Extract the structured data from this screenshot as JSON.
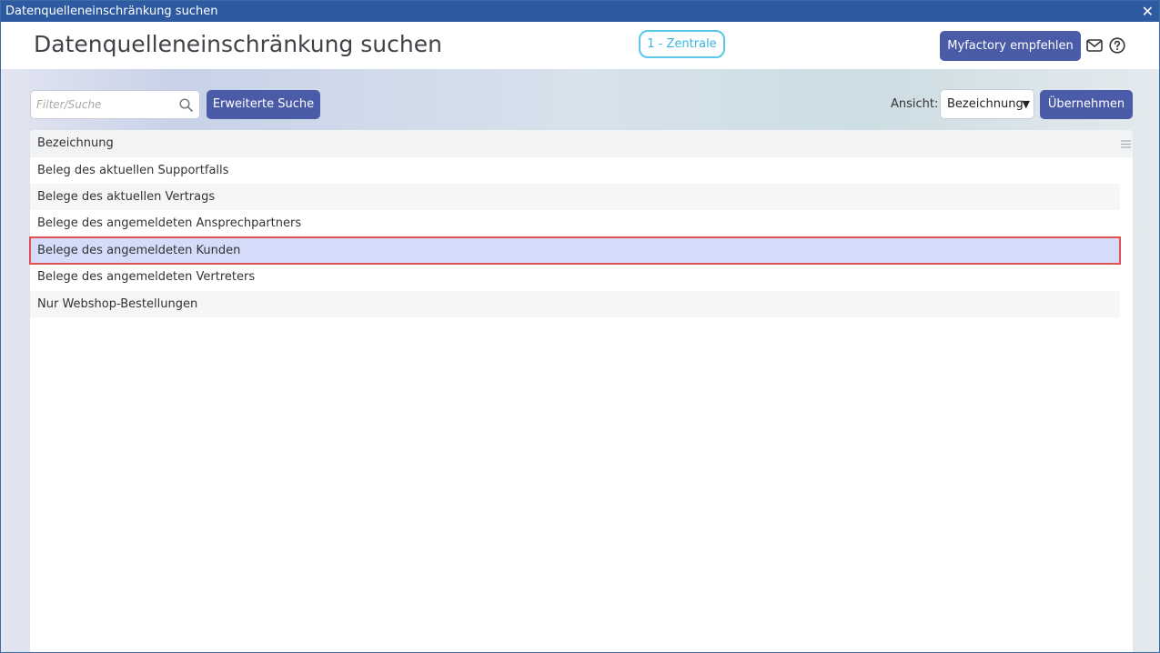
{
  "window": {
    "title": "Datenquelleneinschränkung suchen",
    "close_glyph": "✕"
  },
  "header": {
    "title": "Datenquelleneinschränkung suchen",
    "tenant": "1 - Zentrale",
    "recommend_label": "Myfactory empfehlen",
    "mail_icon": "mail-icon",
    "help_icon": "help-icon"
  },
  "toolbar": {
    "filter_placeholder": "Filter/Suche",
    "filter_value": "",
    "advanced_search_label": "Erweiterte Suche",
    "view_label": "Ansicht:",
    "view_value": "Bezeichnung",
    "apply_label": "Übernehmen"
  },
  "grid": {
    "column_header": "Bezeichnung",
    "rows": [
      {
        "label": "Beleg des aktuellen Supportfalls",
        "selected": false
      },
      {
        "label": "Belege des aktuellen Vertrags",
        "selected": false
      },
      {
        "label": "Belege des angemeldeten Ansprechpartners",
        "selected": false
      },
      {
        "label": "Belege des angemeldeten Kunden",
        "selected": true
      },
      {
        "label": "Belege des angemeldeten Vertreters",
        "selected": false
      },
      {
        "label": "Nur Webshop-Bestellungen",
        "selected": false
      }
    ]
  },
  "colors": {
    "titlebar": "#2d5aa0",
    "primary_button": "#4a5ca8",
    "tenant_badge": "#5ac8e8",
    "selected_row": "#d4dcfa",
    "selection_outline": "#e05050"
  }
}
